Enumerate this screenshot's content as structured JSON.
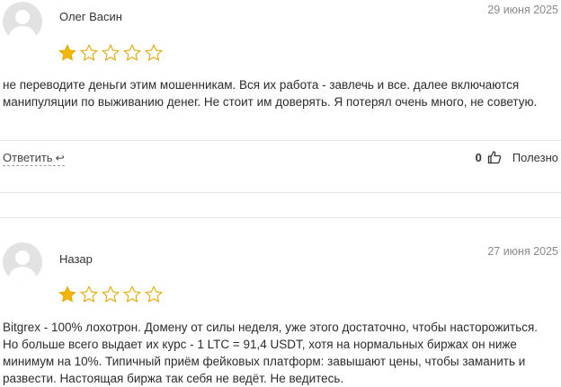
{
  "reviews": [
    {
      "author": "Олег Васин",
      "date": "29 июня 2025",
      "rating": 1,
      "text": "не переводите деньги этим мошенникам. Вся их работа - завлечь и все. далее включаются манипуляции по выживанию денег. Не стоит им доверять. Я потерял очень много, не советую.",
      "reply_label": "Ответить",
      "helpful_count": "0",
      "helpful_label": "Полезно"
    },
    {
      "author": "Назар",
      "date": "27 июня 2025",
      "rating": 1,
      "text": "Bitgrex - 100% лохотрон. Домену от силы неделя, уже этого достаточно, чтобы насторожиться. Но больше всего выдает их курс - 1 LTC = 91,4 USDT, хотя на нормальных биржах он ниже минимум на 10%. Типичный приём фейковых платформ: завышают цены, чтобы заманить и развести. Настоящая биржа так себя не ведёт. Не ведитесь."
    }
  ],
  "colors": {
    "star_filled": "#f2b705",
    "star_empty_stroke": "#e0a800",
    "avatar_bg": "#e2e2e2",
    "avatar_fg": "#ffffff"
  }
}
